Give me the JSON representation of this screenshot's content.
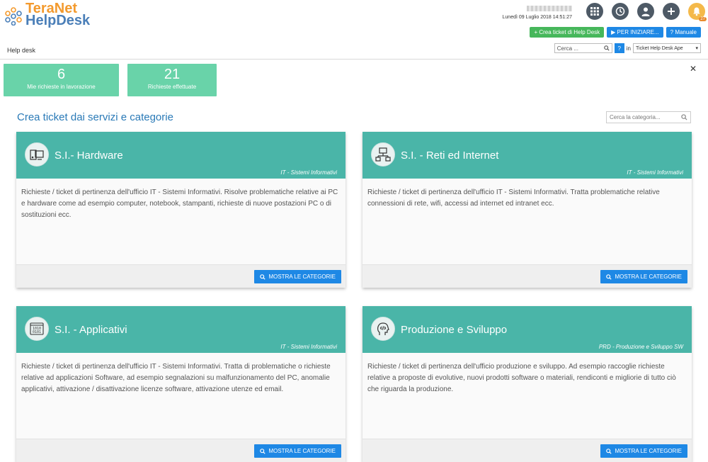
{
  "brand": {
    "line1": "TeraNet",
    "line2": "HelpDesk"
  },
  "header": {
    "datetime": "Lunedì 09 Luglio 2018 14:51:27",
    "notif_count": "27",
    "buttons": {
      "create": "+ Crea ticket di Help Desk",
      "start": "▶ PER INIZIARE...",
      "manual": "? Manuale"
    },
    "breadcrumb": "Help desk",
    "search": {
      "placeholder": "Cerca ...",
      "in_label": "in",
      "scope": "Ticket Help Desk Ape"
    }
  },
  "stats": [
    {
      "value": "6",
      "label": "Mie richieste in lavorazione"
    },
    {
      "value": "21",
      "label": "Richieste effettuate"
    }
  ],
  "section": {
    "title": "Crea ticket dai servizi e categorie",
    "category_search_placeholder": "Cerca la categoria..."
  },
  "cards": [
    {
      "icon": "computer-hardware-icon",
      "title": "S.I.- Hardware",
      "subtitle": "IT - Sistemi Informativi",
      "description": "Richieste / ticket di pertinenza dell'ufficio IT - Sistemi Informativi. Risolve problematiche relative ai PC e hardware come ad esempio computer, notebook, stampanti, richieste di nuove postazioni PC o di sostituzioni ecc.",
      "button": "MOSTRA LE CATEGORIE"
    },
    {
      "icon": "network-icon",
      "title": "S.I. - Reti ed Internet",
      "subtitle": "IT - Sistemi Informativi",
      "description": "Richieste / ticket di pertinenza dell'ufficio IT - Sistemi Informativi. Tratta problematiche relative connessioni di rete, wifi, accessi ad internet ed intranet ecc.",
      "button": "MOSTRA LE CATEGORIE"
    },
    {
      "icon": "binary-code-icon",
      "title": "S.I. - Applicativi",
      "subtitle": "IT - Sistemi Informativi",
      "description": "Richieste / ticket di pertinenza dell'ufficio IT - Sistemi Informativi. Tratta di problematiche o richieste relative ad applicazioni Software, ad esempio segnalazioni su malfunzionamento del PC, anomalie applicativi, attivazione / disattivazione licenze software, attivazione utenze ed email.",
      "button": "MOSTRA LE CATEGORIE"
    },
    {
      "icon": "developer-head-icon",
      "title": "Produzione e Sviluppo",
      "subtitle": "PRD - Produzione e Sviluppo SW",
      "description": "Richieste / ticket di pertinenza dell'ufficio produzione e sviluppo. Ad esempio raccoglie richieste relative a proposte di evolutive, nuovi prodotti software o materiali, rendiconti e migliorie di tutto ciò che riguarda la produzione.",
      "button": "MOSTRA LE CATEGORIE"
    }
  ]
}
